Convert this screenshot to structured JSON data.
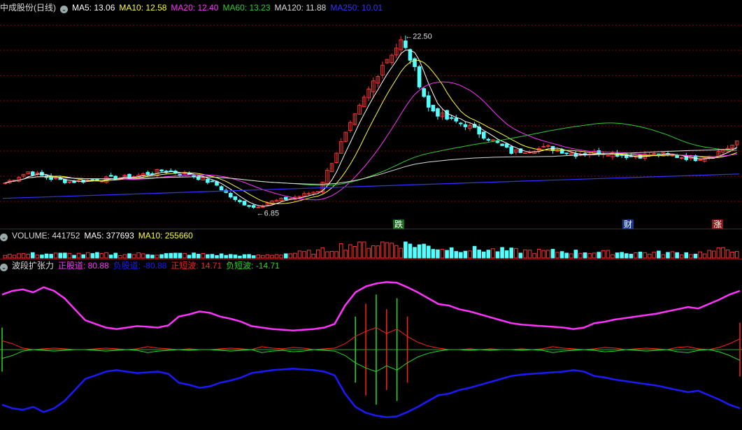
{
  "colors": {
    "bg": "#000000",
    "up": "#ff3232",
    "down": "#54ffff",
    "ma5": "#ffffff",
    "ma10": "#ffff33",
    "ma20": "#ff33ff",
    "ma60": "#33cc33",
    "ma120": "#dddddd",
    "ma250": "#3333ff",
    "grid": "#8b0000",
    "pos_channel": "#ff33ff",
    "neg_channel": "#1a1aff",
    "pos_short": "#ff2020",
    "neg_short": "#22dd22"
  },
  "header_main": {
    "stock": "中成股份(日线)",
    "ma5": "MA5: 13.06",
    "ma10": "MA10: 12.58",
    "ma20": "MA20: 12.40",
    "ma60": "MA60: 13.23",
    "ma120": "MA120: 11.88",
    "ma250": "MA250: 10.01"
  },
  "header_volume": {
    "volume": "VOLUME: 441752",
    "ma5": "MA5: 377693",
    "ma10": "MA10: 255660"
  },
  "header_indicator": {
    "name": "波段扩张力",
    "pos_channel": "正股道: 80.88",
    "neg_channel": "负股道: -80.88",
    "pos_short": "正短波: 14.71",
    "neg_short": "负短波: -14.71"
  },
  "annotations": {
    "high": "22.50",
    "low": "6.85",
    "events": [
      "跌",
      "财",
      "涨"
    ]
  },
  "chart_data": [
    {
      "type": "candlestick",
      "x_count": 160,
      "ylim": [
        5.5,
        24.5
      ],
      "close_anchors": [
        [
          0,
          9.2
        ],
        [
          5,
          10.2
        ],
        [
          10,
          9.6
        ],
        [
          14,
          9.3
        ],
        [
          20,
          9.5
        ],
        [
          28,
          9.8
        ],
        [
          34,
          10.3
        ],
        [
          40,
          10.0
        ],
        [
          46,
          9.0
        ],
        [
          50,
          7.6
        ],
        [
          54,
          7.0
        ],
        [
          58,
          7.5
        ],
        [
          64,
          8.0
        ],
        [
          68,
          8.5
        ],
        [
          72,
          12.0
        ],
        [
          77,
          16.0
        ],
        [
          82,
          20.0
        ],
        [
          86,
          22.0
        ],
        [
          88,
          20.5
        ],
        [
          92,
          16.0
        ],
        [
          96,
          15.0
        ],
        [
          100,
          14.5
        ],
        [
          104,
          13.5
        ],
        [
          110,
          12.0
        ],
        [
          118,
          12.4
        ],
        [
          124,
          11.8
        ],
        [
          130,
          12.0
        ],
        [
          136,
          11.6
        ],
        [
          142,
          11.8
        ],
        [
          150,
          11.4
        ],
        [
          154,
          11.8
        ],
        [
          159,
          12.8
        ]
      ],
      "high": 22.5,
      "low": 6.85,
      "ma_periods": [
        5,
        10,
        20,
        60,
        120,
        250
      ],
      "ma250_range": [
        7.8,
        10.01
      ]
    },
    {
      "type": "bar",
      "name": "VOLUME",
      "volume_anchors": [
        [
          0,
          0.25
        ],
        [
          40,
          0.25
        ],
        [
          55,
          0.15
        ],
        [
          68,
          0.4
        ],
        [
          75,
          0.85
        ],
        [
          86,
          0.95
        ],
        [
          95,
          0.6
        ],
        [
          110,
          0.45
        ],
        [
          130,
          0.35
        ],
        [
          150,
          0.3
        ],
        [
          159,
          0.6
        ]
      ]
    },
    {
      "type": "line",
      "series": [
        {
          "name": "正股道",
          "values": [
            75,
            80,
            82,
            78,
            85,
            80,
            70,
            55,
            40,
            35,
            30,
            28,
            30,
            32,
            31,
            30,
            33,
            45,
            48,
            52,
            50,
            45,
            42,
            38,
            32,
            30,
            28,
            27,
            26,
            27,
            28,
            30,
            35,
            60,
            78,
            86,
            90,
            92,
            91,
            85,
            78,
            70,
            62,
            60,
            55,
            52,
            48,
            44,
            40,
            36,
            34,
            33,
            32,
            31,
            30,
            28,
            30,
            36,
            38,
            41,
            43,
            45,
            47,
            49,
            52,
            55,
            58,
            56,
            62,
            68,
            75,
            80
          ]
        },
        {
          "name": "负股道",
          "values": [
            -75,
            -80,
            -82,
            -78,
            -85,
            -80,
            -70,
            -55,
            -40,
            -35,
            -30,
            -28,
            -30,
            -32,
            -31,
            -30,
            -33,
            -45,
            -48,
            -52,
            -50,
            -45,
            -42,
            -38,
            -32,
            -30,
            -28,
            -27,
            -26,
            -27,
            -28,
            -30,
            -35,
            -60,
            -78,
            -86,
            -90,
            -92,
            -91,
            -85,
            -78,
            -70,
            -62,
            -60,
            -55,
            -52,
            -48,
            -44,
            -40,
            -36,
            -34,
            -33,
            -32,
            -31,
            -30,
            -28,
            -30,
            -36,
            -38,
            -41,
            -43,
            -45,
            -47,
            -49,
            -52,
            -55,
            -58,
            -56,
            -62,
            -68,
            -75,
            -80
          ]
        },
        {
          "name": "正短波",
          "values": [
            12,
            8,
            2,
            0,
            1,
            2,
            1,
            0,
            0,
            1,
            2,
            1,
            0,
            1,
            4,
            2,
            1,
            0,
            1,
            0,
            0,
            1,
            2,
            1,
            0,
            4,
            2,
            1,
            3,
            2,
            0,
            1,
            2,
            8,
            18,
            25,
            30,
            22,
            28,
            18,
            10,
            5,
            2,
            0,
            0,
            1,
            0,
            1,
            0,
            0,
            1,
            0,
            1,
            4,
            2,
            1,
            0,
            1,
            3,
            2,
            0,
            1,
            2,
            1,
            0,
            3,
            4,
            1,
            0,
            3,
            8,
            14.7
          ]
        },
        {
          "name": "负短波",
          "values": [
            -12,
            -8,
            -2,
            0,
            -1,
            -2,
            -1,
            0,
            0,
            -1,
            -2,
            -1,
            0,
            -1,
            -4,
            -2,
            -1,
            0,
            -1,
            0,
            0,
            -1,
            -2,
            -1,
            0,
            -4,
            -2,
            -1,
            -3,
            -2,
            0,
            -1,
            -2,
            -8,
            -18,
            -25,
            -30,
            -22,
            -28,
            -18,
            -10,
            -5,
            -2,
            0,
            0,
            -1,
            0,
            -1,
            0,
            0,
            -1,
            0,
            -1,
            -4,
            -2,
            -1,
            0,
            -1,
            -3,
            -2,
            0,
            -1,
            -2,
            -1,
            0,
            -3,
            -4,
            -1,
            0,
            -3,
            -8,
            -14.7
          ]
        }
      ],
      "ylim": [
        -100,
        100
      ]
    }
  ]
}
